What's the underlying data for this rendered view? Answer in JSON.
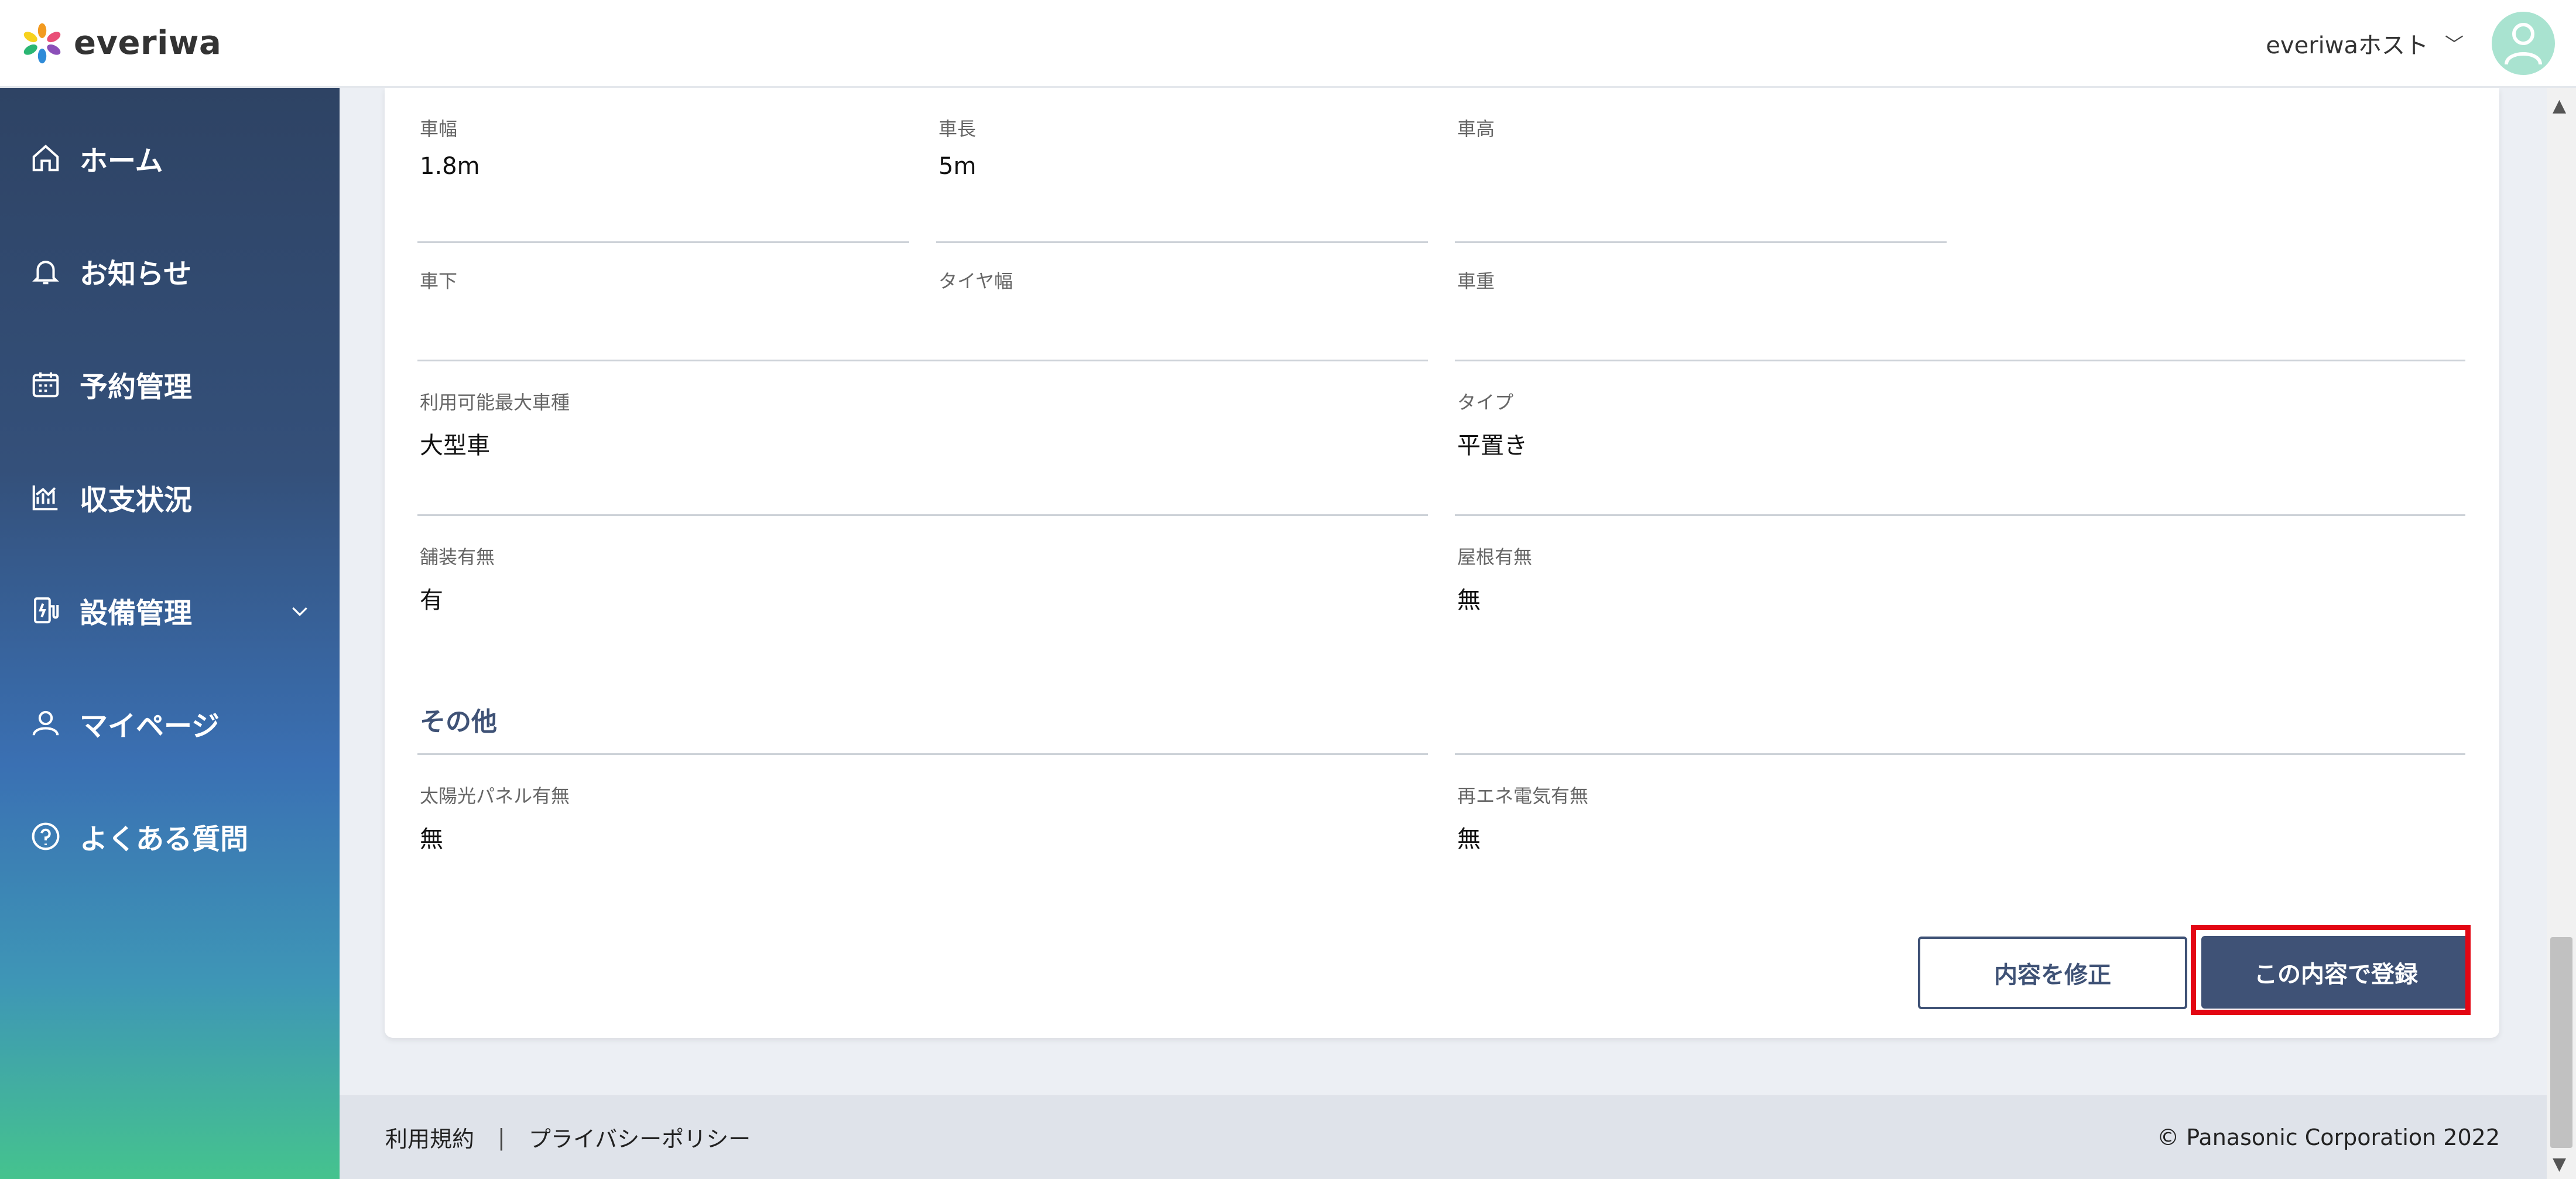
{
  "header": {
    "logo_text": "everiwa",
    "user_name": "everiwaホスト",
    "chevron": "﹀"
  },
  "sidebar": {
    "items": [
      {
        "label": "ホーム",
        "icon": "home-icon"
      },
      {
        "label": "お知らせ",
        "icon": "bell-icon"
      },
      {
        "label": "予約管理",
        "icon": "calendar-icon"
      },
      {
        "label": "収支状況",
        "icon": "chart-icon"
      },
      {
        "label": "設備管理",
        "icon": "charger-icon",
        "expandable": true
      },
      {
        "label": "マイページ",
        "icon": "user-icon"
      },
      {
        "label": "よくある質問",
        "icon": "question-icon"
      }
    ]
  },
  "fields": {
    "width": {
      "label": "車幅",
      "value": "1.8m"
    },
    "length": {
      "label": "車長",
      "value": "5m"
    },
    "height": {
      "label": "車高",
      "value": ""
    },
    "clearance": {
      "label": "車下",
      "value": ""
    },
    "tire_width": {
      "label": "タイヤ幅",
      "value": ""
    },
    "weight": {
      "label": "車重",
      "value": ""
    },
    "max_vehicle": {
      "label": "利用可能最大車種",
      "value": "大型車"
    },
    "type": {
      "label": "タイプ",
      "value": "平置き"
    },
    "paved": {
      "label": "舗装有無",
      "value": "有"
    },
    "roof": {
      "label": "屋根有無",
      "value": "無"
    },
    "solar": {
      "label": "太陽光パネル有無",
      "value": "無"
    },
    "renewable": {
      "label": "再エネ電気有無",
      "value": "無"
    }
  },
  "sections": {
    "other": "その他"
  },
  "buttons": {
    "edit": "内容を修正",
    "register": "この内容で登録"
  },
  "footer": {
    "terms": "利用規約",
    "separator": "|",
    "privacy": "プライバシーポリシー",
    "copyright": "© Panasonic Corporation 2022"
  }
}
